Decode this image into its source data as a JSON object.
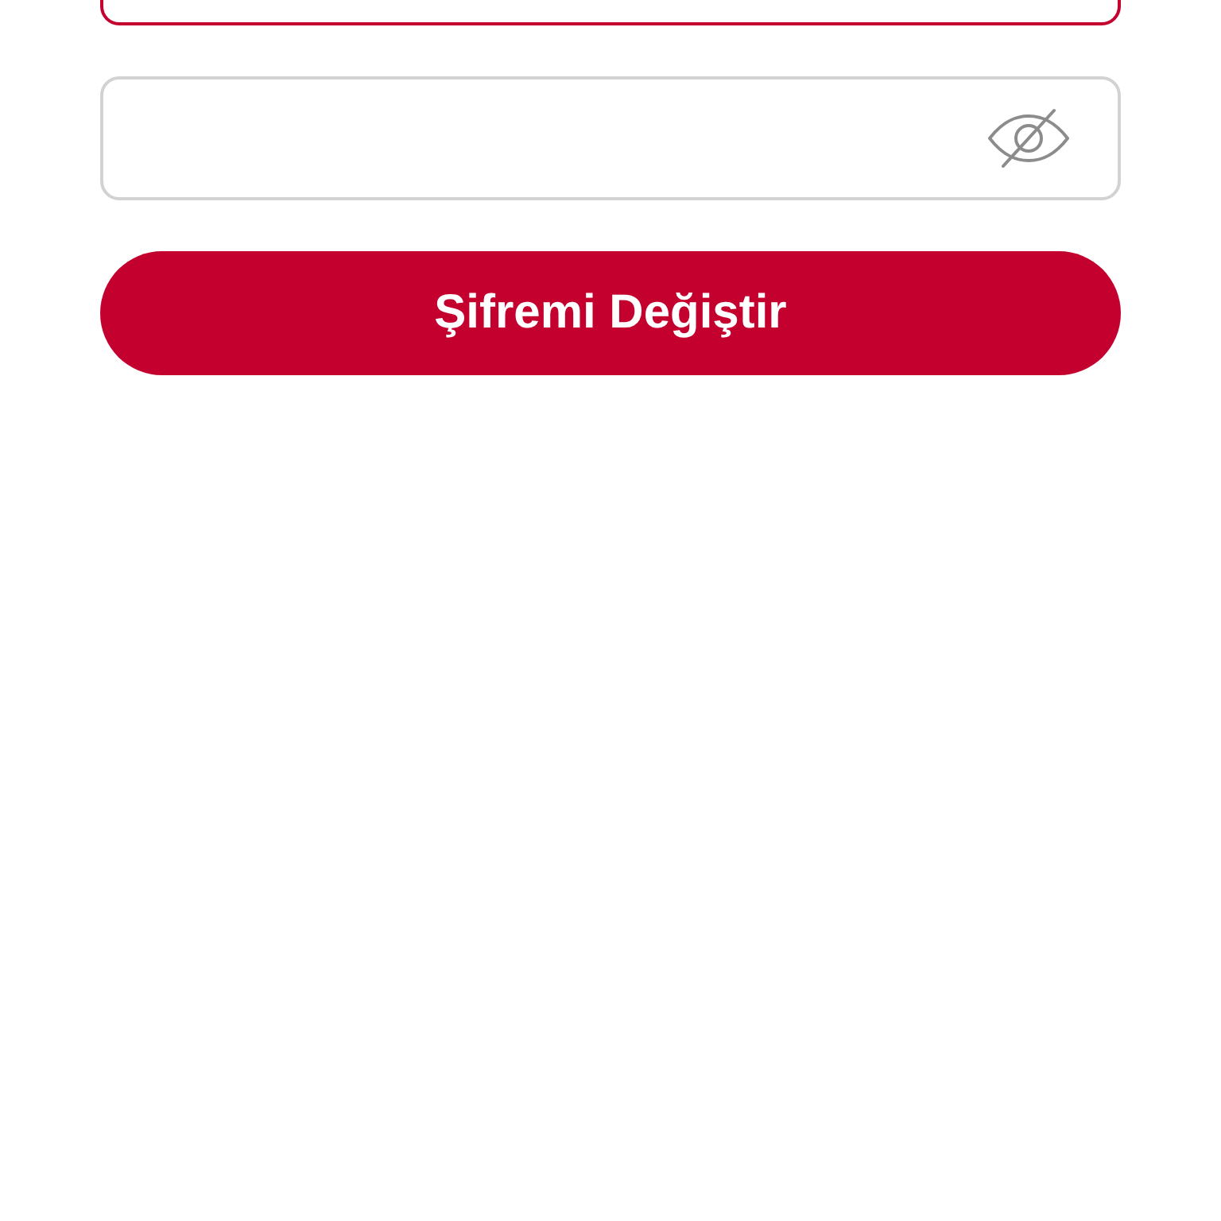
{
  "top_field": {
    "focused": true
  },
  "password_field": {
    "focused": false,
    "password_visible": false
  },
  "submit_button": {
    "label": "Şifremi Değiştir"
  }
}
